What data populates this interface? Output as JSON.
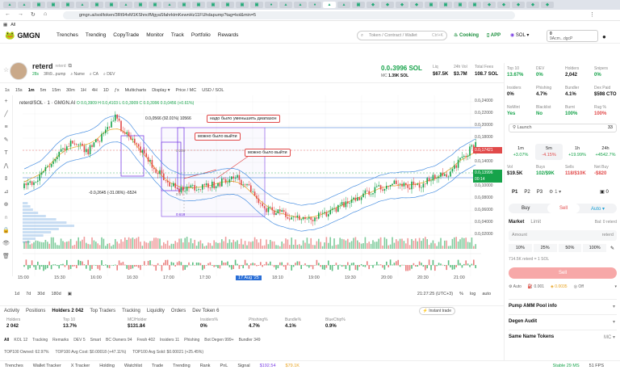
{
  "browser": {
    "url": "gmgn.ai/sol/token/3Rt94vM1KShncfMgyaSfahrktmKewnHz11FUhdapump?tag=kol&min=5",
    "tab_count_label": "9"
  },
  "header": {
    "logo": "GMGN",
    "nav": [
      "Trenches",
      "Trending",
      "CopyTrade",
      "Monitor",
      "Track",
      "Portfolio",
      "Rewards"
    ],
    "search_placeholder": "Token / Contract / Wallet",
    "search_shortcut": "Ctrl+K",
    "cooking": "Cooking",
    "cooking_badge": "Free",
    "app": "APP",
    "chain": "SOL",
    "wallet_balance": "0",
    "wallet_addr": "9Acm...dgcP"
  },
  "token": {
    "name": "reterd",
    "fullname": "reterd",
    "age": "28s",
    "ca_short": "3Rt9...pump",
    "links": [
      "Name",
      "CA",
      "DEV"
    ],
    "price": "0.0₁3996 SOL",
    "mc_label": "MC",
    "mc": "1.39K SOL",
    "liq_label": "Liq",
    "liq": "$67.5K",
    "vol_label": "24h Vol",
    "vol": "$3.7M",
    "fees_label": "Total Fees",
    "fees": "108.7 SOL"
  },
  "chart_toolbar": {
    "intervals": [
      "1s",
      "15s",
      "1m",
      "5m",
      "15m",
      "30m",
      "1H",
      "4H",
      "1D"
    ],
    "active_interval": "1m",
    "multicharts": "Multicharts",
    "display": "Display",
    "price_mc": "Price / MC",
    "usd_sol": "USD / SOL",
    "legend": "reterd/SOL · 1 · GMGN.AI",
    "ohlc": "O 0.0₁3909 H 0.0₁4103 L 0.0₁3909 C 0.0₁3996 0.0₁0456 (+0.61%)"
  },
  "annotations": [
    {
      "text": "надо было уменьшить диапазон"
    },
    {
      "text": "можно было выйти"
    },
    {
      "text": "можно было выйти"
    }
  ],
  "measure_labels": [
    "0.0₁0566 (92.01%) 10566",
    "-0.0₁2645 (-31.06%) -6524"
  ],
  "fib_labels": [
    "0.236",
    "0.5",
    "0.618"
  ],
  "price_scale": [
    "0.0₁24000",
    "0.0₁22000",
    "0.0₁20000",
    "0.0₁18000",
    "0.0₁16000",
    "0.0₁14000",
    "0.0₁12000",
    "0.0₁10000",
    "0.0₁08000",
    "0.0₁06000",
    "0.0₁04000",
    "0.0₁02000"
  ],
  "price_tags": [
    {
      "label": "0.0₁17421",
      "color": "#e14a4a"
    },
    {
      "label": "0.0₁13996",
      "color": "#16a34a"
    },
    {
      "label": "00:14",
      "color": "#16a34a"
    }
  ],
  "time_axis": [
    "15:00",
    "15:30",
    "16:00",
    "16:30",
    "17:00",
    "17:30",
    "17 Aug '25",
    "18:10",
    "19:00",
    "19:30",
    "20:00",
    "20:30",
    "21:00"
  ],
  "range_bar": {
    "ranges": [
      "1d",
      "7d",
      "30d",
      "180d"
    ],
    "clock": "21:27:25 (UTC+3)",
    "pct": "%",
    "log": "log",
    "auto": "auto"
  },
  "bottom": {
    "tabs": [
      "Activity",
      "Positions",
      "Holders 2 042",
      "Top Traders",
      "Tracking",
      "Liquidity",
      "Orders",
      "Dev Token 6"
    ],
    "active_tab": "Holders 2 042",
    "instant_trade": "Instant trade",
    "stats": [
      {
        "label": "Holders",
        "value": "2 042"
      },
      {
        "label": "Top 10",
        "value": "13.7%"
      },
      {
        "label": "MC/Holder",
        "value": "$131.84"
      },
      {
        "label": "Insiders%",
        "value": "0%"
      },
      {
        "label": "Phishing%",
        "value": "4.7%"
      },
      {
        "label": "Bundle%",
        "value": "4.1%"
      },
      {
        "label": "BlueChip%",
        "value": "0.9%"
      }
    ],
    "filters": [
      "All",
      "KOL 12",
      "Tracking",
      "Remarks",
      "DEV 5",
      "Smart",
      "BC Owners 94",
      "Fresh 402",
      "Insiders 11",
      "Phishing",
      "Bot Degen 999+",
      "Bundler 349"
    ],
    "top_stats": [
      "TOP100 Owned: 62.97%",
      "TOP100 Avg Cost: $0.00018 (+47.11%)",
      "TOP100 Avg Sold: $0.00021 (+25.45%)"
    ]
  },
  "status": {
    "items": [
      "Trenches",
      "Wallet Tracker",
      "X Tracker",
      "Holding",
      "Watchlist",
      "Trade",
      "Trending",
      "Rank",
      "PnL",
      "Signal"
    ],
    "sol_price": "$192.54",
    "btc": "$79.1K",
    "stable": "Stable 29 MS",
    "fps": "51 FPS"
  },
  "right": {
    "grid": [
      {
        "label": "Top 10",
        "value": "13.67%",
        "color": "green"
      },
      {
        "label": "DEV",
        "value": "0%",
        "color": "green"
      },
      {
        "label": "Holders",
        "value": "2,042",
        "color": ""
      },
      {
        "label": "Snipers",
        "value": "0%",
        "color": "green"
      },
      {
        "label": "Insiders",
        "value": "0%",
        "color": ""
      },
      {
        "label": "Phishing",
        "value": "4.7%",
        "color": ""
      },
      {
        "label": "Bundler",
        "value": "4.1%",
        "color": ""
      },
      {
        "label": "Dex Paid",
        "value": "$598 CTO",
        "color": ""
      },
      {
        "label": "NoMint",
        "value": "Yes",
        "color": "green"
      },
      {
        "label": "Blacklist",
        "value": "No",
        "color": "green"
      },
      {
        "label": "Burnt",
        "value": "100%",
        "color": "green"
      },
      {
        "label": "Rug %",
        "value": "100%",
        "color": "red"
      }
    ],
    "launch": "Launch",
    "launch_count": "33",
    "timeframes": [
      {
        "label": "1m",
        "value": "+3.07%",
        "color": "green"
      },
      {
        "label": "5m",
        "value": "-4.15%",
        "color": "red"
      },
      {
        "label": "1h",
        "value": "+19.99%",
        "color": "green"
      },
      {
        "label": "24h",
        "value": "+4542.7%",
        "color": "green"
      }
    ],
    "vols": [
      {
        "label": "Vol",
        "value": "$19.5K",
        "color": ""
      },
      {
        "label": "Buys",
        "value": "102/$9K",
        "color": "green"
      },
      {
        "label": "Sells",
        "value": "118/$10K",
        "color": "red"
      },
      {
        "label": "Net Buy",
        "value": "-$820",
        "color": "red"
      }
    ],
    "presets": [
      "P1",
      "P2",
      "P3"
    ],
    "preset_info": "1",
    "preset_right": "0",
    "buy": "Buy",
    "sell": "Sell",
    "auto": "Auto",
    "market": "Market",
    "limit": "Limit",
    "bal": "Bal: 0 reterd",
    "amount_placeholder": "Amount",
    "amount_unit": "reterd",
    "pct_buttons": [
      "10%",
      "25%",
      "50%",
      "100%"
    ],
    "hold_line": "714.5K reterd = 1 SOL",
    "sell_button": "Sell",
    "settings_row": [
      "Auto",
      "0.001",
      "0.0035",
      "Off"
    ],
    "sections": [
      "Pump AMM Pool info",
      "Degen Audit",
      "Same Name Tokens"
    ],
    "mc_tag": "MC"
  },
  "chart_data": {
    "type": "candlestick",
    "title": "reterd/SOL · 1 · GMGN.AI",
    "x_range": [
      "15:00",
      "21:10"
    ],
    "ylim": [
      2e-07,
      2.5e-06
    ],
    "close_series": [
      1.06e-05,
      1.2e-05,
      2e-05,
      1.5e-05,
      1.9e-05,
      2e-05,
      2.2e-05,
      1.9e-05,
      1.5e-05,
      1.2e-05,
      1.1e-05,
      1.35e-05,
      1.3e-05,
      1.25e-05,
      1.1e-05,
      1.05e-05,
      9.8e-06,
      9e-06,
      9.5e-06,
      9e-06,
      9.8e-06,
      1.1e-05,
      1.2e-05,
      1.28e-05,
      1.35e-05,
      1.5e-05,
      1.74e-05,
      1.4e-05
    ]
  }
}
